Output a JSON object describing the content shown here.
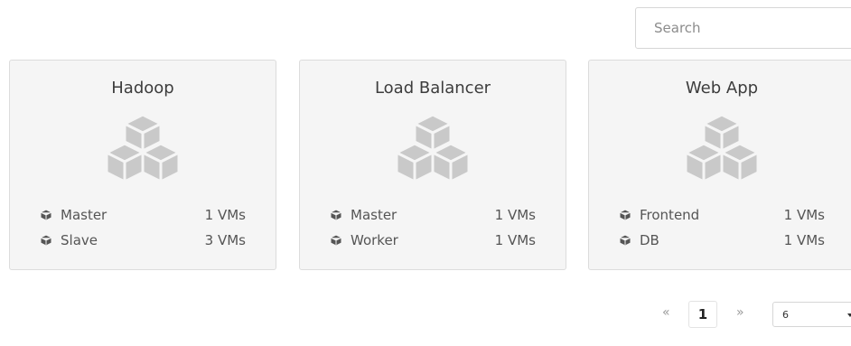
{
  "search": {
    "placeholder": "Search",
    "value": ""
  },
  "cards": [
    {
      "title": "Hadoop",
      "icon": "cubes-icon",
      "roles": [
        {
          "name": "Master",
          "count": "1 VMs"
        },
        {
          "name": "Slave",
          "count": "3 VMs"
        }
      ]
    },
    {
      "title": "Load Balancer",
      "icon": "cubes-icon",
      "roles": [
        {
          "name": "Master",
          "count": "1 VMs"
        },
        {
          "name": "Worker",
          "count": "1 VMs"
        }
      ]
    },
    {
      "title": "Web App",
      "icon": "cubes-icon",
      "roles": [
        {
          "name": "Frontend",
          "count": "1 VMs"
        },
        {
          "name": "DB",
          "count": "1 VMs"
        }
      ]
    }
  ],
  "pagination": {
    "prev": "«",
    "current_page": "1",
    "next": "»",
    "page_size": "6"
  },
  "colors": {
    "card_bg": "#f5f5f5",
    "card_border": "#dcdcdc",
    "icon_gray": "#c9c9c9",
    "text": "#4d4d4d"
  }
}
